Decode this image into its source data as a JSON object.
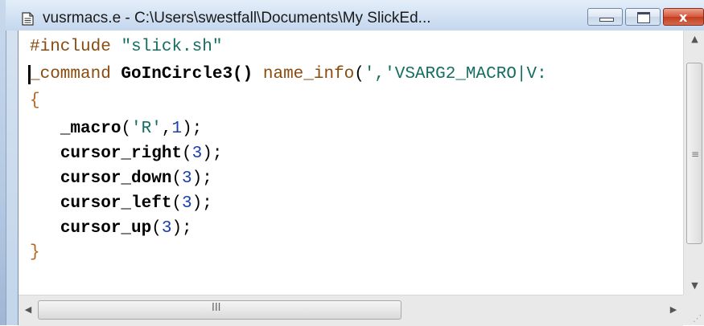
{
  "window": {
    "title": "vusrmacs.e - C:\\Users\\swestfall\\Documents\\My SlickEd...",
    "icon": "document-icon",
    "buttons": {
      "minimize": "minimize",
      "maximize": "maximize",
      "close": "x"
    }
  },
  "colors": {
    "keyword": "#8a4b0f",
    "string": "#156e62",
    "number": "#1a3fa8",
    "close_button": "#c23d1f",
    "titlebar": "#d2e1f2"
  },
  "code": {
    "lines": [
      {
        "kw": "#include",
        "sp": " ",
        "str": "\"slick.sh\""
      },
      {
        "kw": "_command",
        "id": " GoInCircle3()",
        "fn": " name_info",
        "p1": "(",
        "str": "','VSARG2_MACRO|V:"
      },
      {
        "brace": "{"
      },
      {
        "indent": "   ",
        "id": "_macro",
        "p1": "(",
        "str": "'R'",
        "p2": ",",
        "num": "1",
        "p3": ");"
      },
      {
        "indent": "   ",
        "id": "cursor_right",
        "p1": "(",
        "num": "3",
        "p3": ");"
      },
      {
        "indent": "   ",
        "id": "cursor_down",
        "p1": "(",
        "num": "3",
        "p3": ");"
      },
      {
        "indent": "   ",
        "id": "cursor_left",
        "p1": "(",
        "num": "3",
        "p3": ");"
      },
      {
        "indent": "   ",
        "id": "cursor_up",
        "p1": "(",
        "num": "3",
        "p3": ");"
      },
      {
        "brace": "}"
      }
    ]
  },
  "scrollbars": {
    "up_arrow": "▲",
    "down_arrow": "▼",
    "left_arrow": "◀",
    "right_arrow": "▶",
    "v_grip": "≡",
    "h_grip": "III",
    "size_grip": "⋰"
  }
}
